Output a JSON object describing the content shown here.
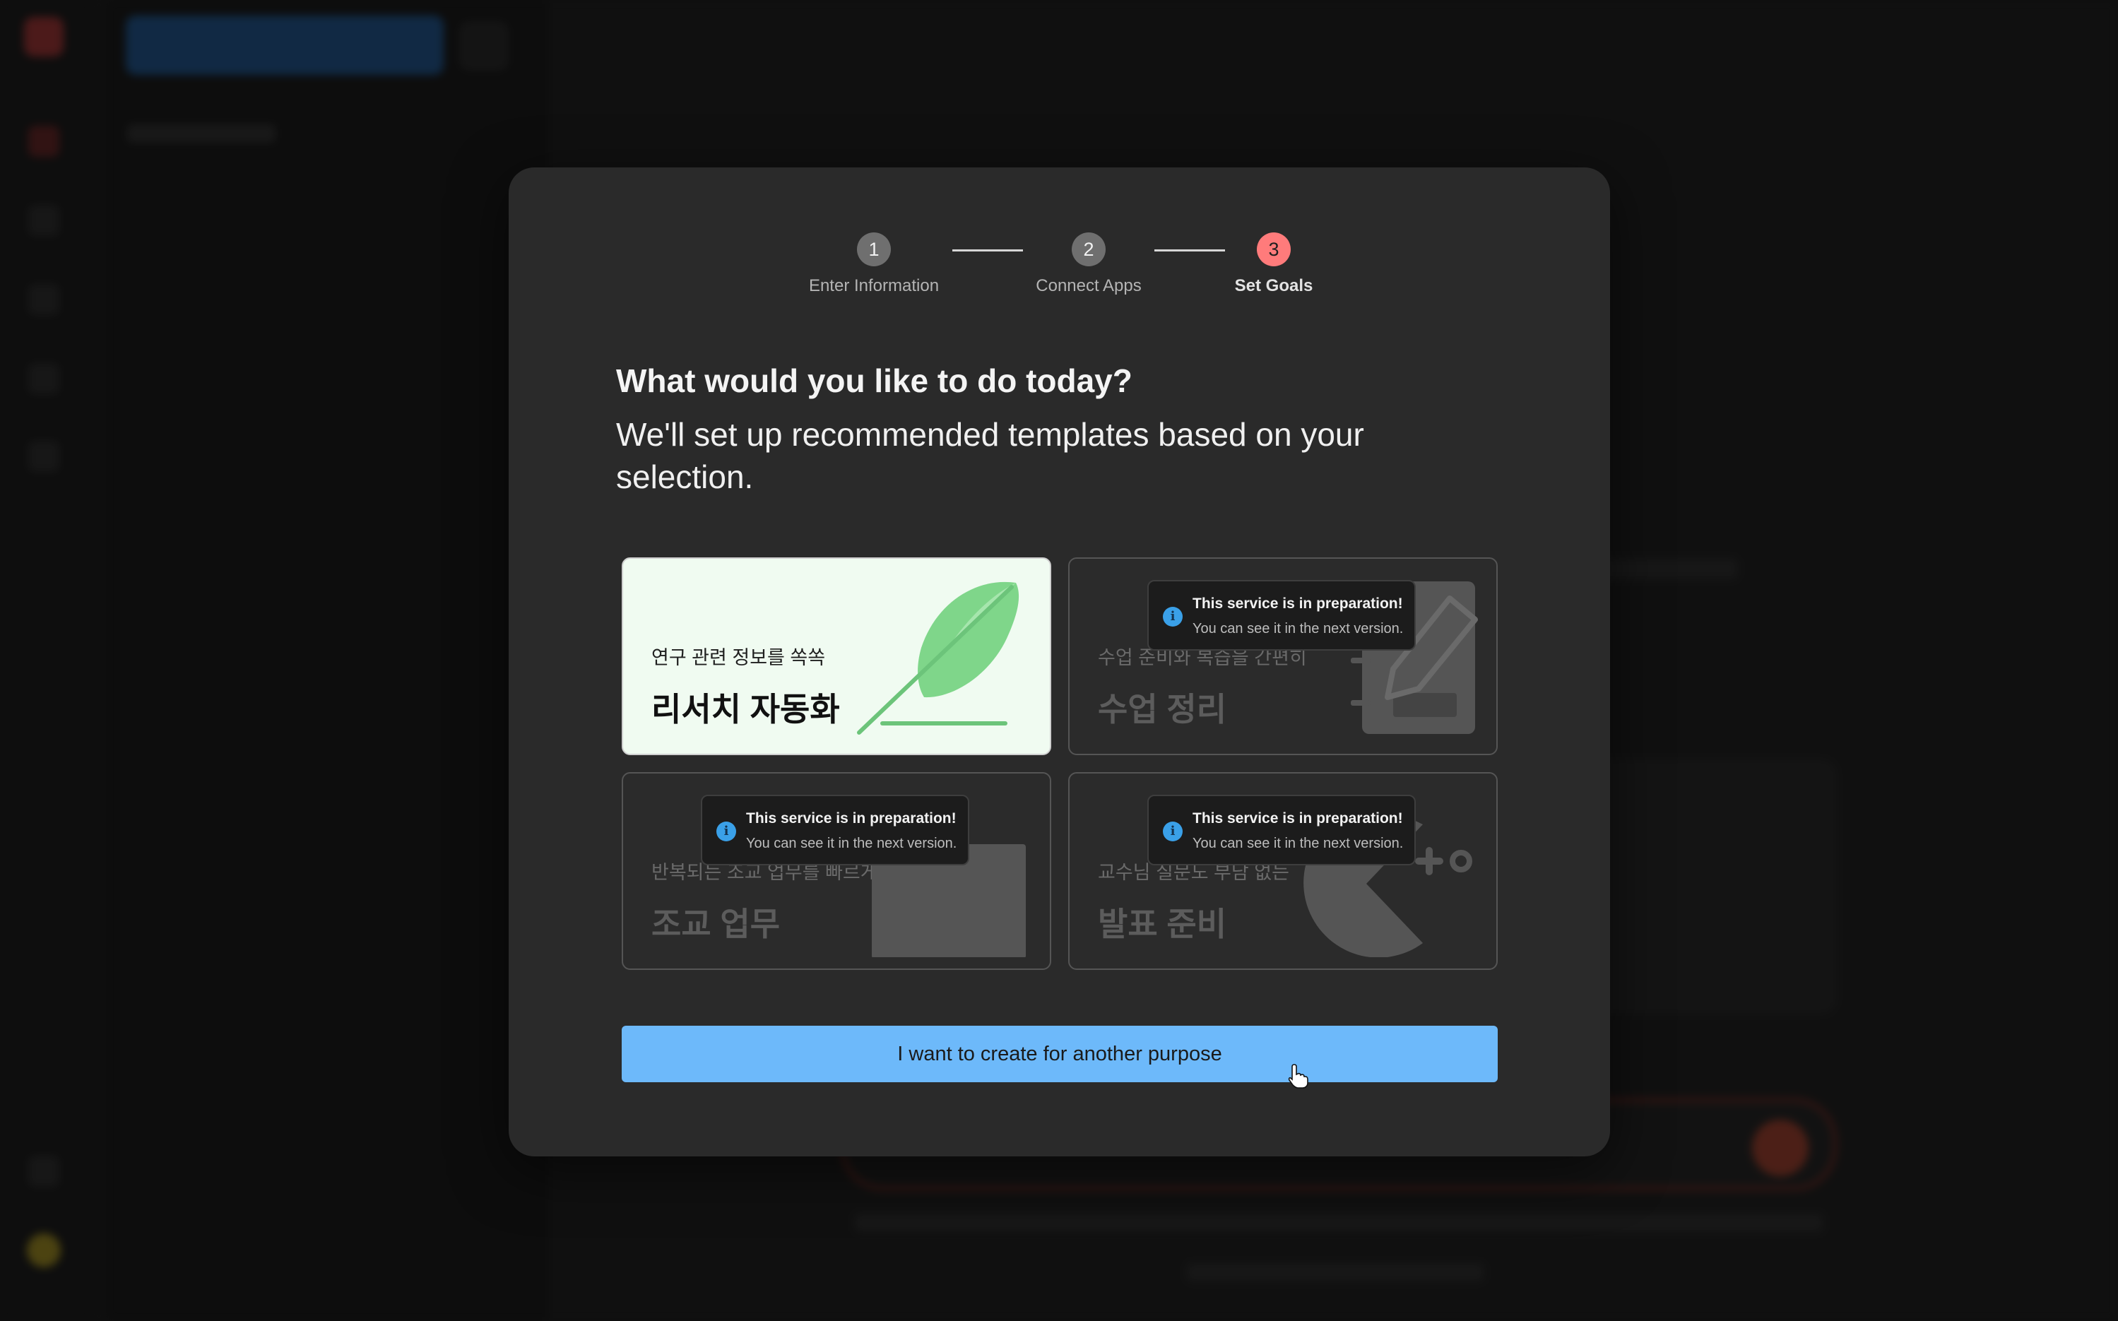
{
  "stepper": {
    "steps": [
      {
        "number": "1",
        "label": "Enter Information",
        "state": "done"
      },
      {
        "number": "2",
        "label": "Connect Apps",
        "state": "done"
      },
      {
        "number": "3",
        "label": "Set Goals",
        "state": "active"
      }
    ]
  },
  "heading": "What would you like to do today?",
  "subheading": "We'll set up recommended templates based on your selection.",
  "options": [
    {
      "subtitle": "연구 관련 정보를 쏙쏙",
      "title": "리서치 자동화",
      "icon": "feather-pen-icon",
      "selected": true
    },
    {
      "subtitle": "수업 준비와 복습을 간편히",
      "title": "수업 정리",
      "icon": "notebook-pen-icon",
      "selected": false
    },
    {
      "subtitle": "반복되는 조교 업무를 빠르게",
      "title": "조교 업무",
      "icon": "shopping-bag-icon",
      "selected": false
    },
    {
      "subtitle": "교수님 질문도 부담 없는",
      "title": "발표 준비",
      "icon": "pacman-icon",
      "selected": false
    }
  ],
  "tooltip": {
    "title": "This service is in preparation!",
    "text": "You can see it in the next version."
  },
  "cta_label": "I want to create for another purpose",
  "colors": {
    "active_step": "#ff7b7b",
    "cta": "#6db9fa",
    "selected_card": "#f0fbf1",
    "feather_green": "#7fd68a",
    "info_blue": "#3aa0e8"
  }
}
